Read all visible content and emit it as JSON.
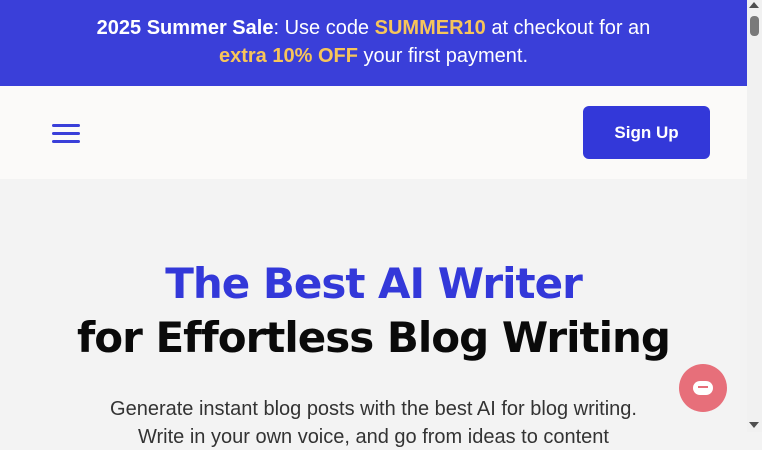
{
  "promo": {
    "title": "2025 Summer Sale",
    "text_a": ": Use code ",
    "code": "SUMMER10",
    "text_b": " at checkout for an",
    "offer": "extra 10% OFF",
    "text_c": " your first payment."
  },
  "nav": {
    "menu_icon": "hamburger-menu-icon",
    "signup_label": "Sign Up"
  },
  "hero": {
    "headline_line1": "The Best AI Writer",
    "headline_line2": "for Effortless Blog Writing",
    "subtext_line1": "Generate instant blog posts with the best AI for blog writing.",
    "subtext_line2": "Write in your own voice, and go from ideas to content"
  },
  "chat": {
    "icon": "chat-bubble-icon"
  },
  "colors": {
    "brand": "#3338d9",
    "promo_accent": "#f7c55a",
    "chat": "#e76f7a"
  }
}
